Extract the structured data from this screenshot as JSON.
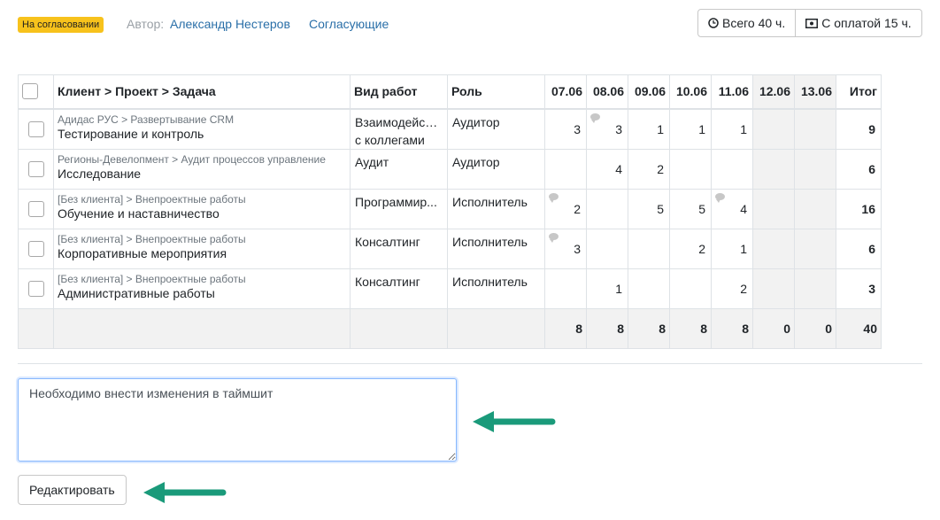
{
  "header": {
    "status_badge": "На согласовании",
    "author_label": "Автор:",
    "author_name": "Александр Нестеров",
    "approvers_link": "Согласующие",
    "total_hours": "Всего 40 ч.",
    "paid_hours": "С оплатой 15 ч."
  },
  "table": {
    "headers": {
      "task": "Клиент > Проект > Задача",
      "work_type": "Вид работ",
      "role": "Роль",
      "days": [
        "07.06",
        "08.06",
        "09.06",
        "10.06",
        "11.06",
        "12.06",
        "13.06"
      ],
      "total": "Итог"
    },
    "rows": [
      {
        "path": "Адидас РУС > Развертывание CRM",
        "task": "Тестирование и контроль",
        "work_type": "Взаимодейств...",
        "work_type_line2": "с коллегами",
        "role": "Аудитор",
        "days": [
          "3",
          "3",
          "1",
          "1",
          "1",
          "",
          ""
        ],
        "total": "9"
      },
      {
        "path": "Регионы-Девелопмент > Аудит процессов управление",
        "task": "Исследование",
        "work_type": "Аудит",
        "work_type_line2": "",
        "role": "Аудитор",
        "days": [
          "",
          "4",
          "2",
          "",
          "",
          "",
          ""
        ],
        "total": "6"
      },
      {
        "path": "[Без клиента] > Внепроектные работы",
        "task": "Обучение и наставничество",
        "work_type": "Программир...",
        "work_type_line2": "",
        "role": "Исполнитель",
        "days": [
          "2",
          "",
          "5",
          "5",
          "4",
          "",
          ""
        ],
        "total": "16"
      },
      {
        "path": "[Без клиента] > Внепроектные работы",
        "task": "Корпоративные мероприятия",
        "work_type": "Консалтинг",
        "work_type_line2": "",
        "role": "Исполнитель",
        "days": [
          "3",
          "",
          "",
          "2",
          "1",
          "",
          ""
        ],
        "total": "6"
      },
      {
        "path": "[Без клиента] > Внепроектные работы",
        "task": "Административные работы",
        "work_type": "Консалтинг",
        "work_type_line2": "",
        "role": "Исполнитель",
        "days": [
          "",
          "1",
          "",
          "",
          "2",
          "",
          ""
        ],
        "total": "3"
      }
    ],
    "footer": {
      "days": [
        "8",
        "8",
        "8",
        "8",
        "8",
        "0",
        "0"
      ],
      "total": "40"
    }
  },
  "comment": {
    "value": "Необходимо внести изменения в таймшит"
  },
  "edit_button": "Редактировать",
  "colors": {
    "badge": "#f7c21c",
    "link": "#2a6fa8",
    "arrow": "#1a9a7a",
    "weekend": "#f2f2f2"
  },
  "icons": [
    "clock-icon",
    "money-icon",
    "comment-icon",
    "arrow-left-icon"
  ]
}
